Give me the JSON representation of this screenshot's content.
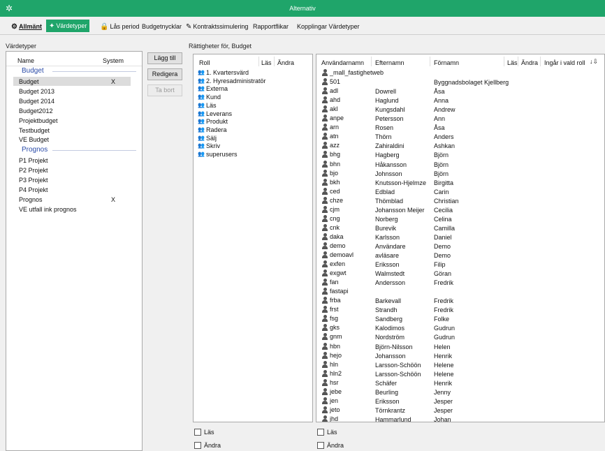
{
  "window": {
    "title": "Alternativ"
  },
  "toolbar": {
    "tabs": [
      {
        "label": "Allmänt",
        "icon": "gear-icon"
      },
      {
        "label": "Värdetyper",
        "icon": "values-icon"
      },
      {
        "label": "Lås period",
        "icon": "lock-icon"
      },
      {
        "label": "Budgetnycklar",
        "icon": ""
      },
      {
        "label": "Kontraktssimulering",
        "icon": "edit-icon"
      },
      {
        "label": "Rapportflikar",
        "icon": ""
      },
      {
        "label": "Kopplingar Värdetyper",
        "icon": ""
      }
    ]
  },
  "values_panel": {
    "title": "Värdetyper",
    "col_name": "Name",
    "col_system": "System",
    "groups": [
      {
        "header": "Budget",
        "items": [
          {
            "name": "Budget",
            "system": "X",
            "selected": true
          },
          {
            "name": "Budget 2013",
            "system": ""
          },
          {
            "name": "Budget 2014",
            "system": ""
          },
          {
            "name": "Budget2012",
            "system": ""
          },
          {
            "name": "Projektbudget",
            "system": ""
          },
          {
            "name": "Testbudget",
            "system": ""
          },
          {
            "name": "VE Budget",
            "system": ""
          }
        ]
      },
      {
        "header": "Prognos",
        "items": [
          {
            "name": "P1 Projekt",
            "system": ""
          },
          {
            "name": "P2 Projekt",
            "system": ""
          },
          {
            "name": "P3 Projekt",
            "system": ""
          },
          {
            "name": "P4 Projekt",
            "system": ""
          },
          {
            "name": "Prognos",
            "system": "X"
          },
          {
            "name": "VE utfall ink prognos",
            "system": ""
          }
        ]
      }
    ]
  },
  "buttons": {
    "add": "Lägg till",
    "edit": "Redigera",
    "delete": "Ta bort"
  },
  "rights": {
    "title": "Rättigheter för, Budget",
    "roles_header": {
      "role": "Roll",
      "read": "Läs",
      "change": "Ändra"
    },
    "roles": [
      "1. Kvartersvärd",
      "2. Hyresadministratör",
      "Externa",
      "Kund",
      "Läs",
      "Leverans",
      "Produkt",
      "Radera",
      "Sälj",
      "Skriv",
      "superusers"
    ],
    "users_header": {
      "username": "Användarnamn",
      "lastname": "Efternamn",
      "firstname": "Förnamn",
      "read": "Läs",
      "change": "Ändra",
      "in_role": "Ingår i vald roll"
    },
    "users": [
      [
        "_mall_fastighetweb",
        "",
        ""
      ],
      [
        "501",
        "",
        "Byggnadsbolaget Kjellberg"
      ],
      [
        "adl",
        "Dowrell",
        "Åsa"
      ],
      [
        "ahd",
        "Haglund",
        "Anna"
      ],
      [
        "akl",
        "Kungsdahl",
        "Andrew"
      ],
      [
        "anpe",
        "Petersson",
        "Ann"
      ],
      [
        "arn",
        "Rosen",
        "Åsa"
      ],
      [
        "atn",
        "Thörn",
        "Anders"
      ],
      [
        "azz",
        "Zahiraldini",
        "Ashkan"
      ],
      [
        "bhg",
        "Hagberg",
        "Björn"
      ],
      [
        "bhn",
        "Håkansson",
        "Björn"
      ],
      [
        "bjo",
        "Johnsson",
        "Björn"
      ],
      [
        "bkh",
        "Knutsson-Hjelmze",
        "Birgitta"
      ],
      [
        "ced",
        "Edblad",
        "Carin"
      ],
      [
        "chze",
        "Thömblad",
        "Christian"
      ],
      [
        "cjm",
        "Johansson Meijer",
        "Cecilia"
      ],
      [
        "cng",
        "Norberg",
        "Celina"
      ],
      [
        "cnk",
        "Burevik",
        "Camilla"
      ],
      [
        "daka",
        "Karlsson",
        "Daniel"
      ],
      [
        "demo",
        "Användare",
        "Demo"
      ],
      [
        "demoavl",
        "avläsare",
        "Demo"
      ],
      [
        "exfen",
        "Eriksson",
        "Filip"
      ],
      [
        "exgwt",
        "Walmstedt",
        "Göran"
      ],
      [
        "fan",
        "Andersson",
        "Fredrik"
      ],
      [
        "fastapi",
        "",
        ""
      ],
      [
        "frba",
        "Barkevall",
        "Fredrik"
      ],
      [
        "frst",
        "Strandh",
        "Fredrik"
      ],
      [
        "fsg",
        "Sandberg",
        "Folke"
      ],
      [
        "gks",
        "Kalodimos",
        "Gudrun"
      ],
      [
        "gnm",
        "Nordström",
        "Gudrun"
      ],
      [
        "hbn",
        "Björn-Nilsson",
        "Helen"
      ],
      [
        "hejo",
        "Johansson",
        "Henrik"
      ],
      [
        "hln",
        "Larsson-Schöön",
        "Helene"
      ],
      [
        "hln2",
        "Larsson-Schöön",
        "Helene"
      ],
      [
        "hsr",
        "Schäfer",
        "Henrik"
      ],
      [
        "jebe",
        "Beurling",
        "Jenny"
      ],
      [
        "jen",
        "Eriksson",
        "Jesper"
      ],
      [
        "jeto",
        "Törnkrantz",
        "Jesper"
      ],
      [
        "jhd",
        "Hammarlund",
        "Johan"
      ]
    ],
    "checkbox_read": "Läs",
    "checkbox_change": "Ändra"
  }
}
